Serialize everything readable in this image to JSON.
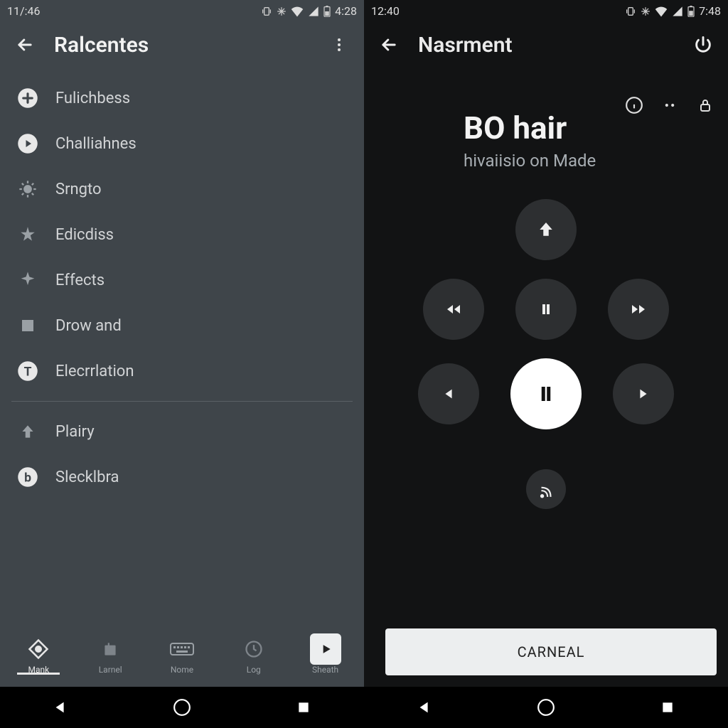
{
  "left": {
    "status": {
      "time": "11/:46",
      "clock": "4:28"
    },
    "appbar": {
      "title": "Ralcentes"
    },
    "list": [
      {
        "icon": "plus-circle-icon",
        "label": "Fulichbess"
      },
      {
        "icon": "play-circle-icon",
        "label": "Challiahnes"
      },
      {
        "icon": "sun-icon",
        "label": "Srngto"
      },
      {
        "icon": "star-icon",
        "label": "Edicdiss"
      },
      {
        "icon": "sparkle-icon",
        "label": "Effects"
      },
      {
        "icon": "square-icon",
        "label": "Drow and"
      },
      {
        "icon": "t-circle-icon",
        "label": "Elecrrlation"
      }
    ],
    "list2": [
      {
        "icon": "arrow-up-icon",
        "label": "Plairy"
      },
      {
        "icon": "b-circle-icon",
        "label": "Slecklbra"
      }
    ],
    "bnav": [
      {
        "label": "Mank",
        "icon": "diamond-icon",
        "active": true
      },
      {
        "label": "Larnel",
        "icon": "box-icon"
      },
      {
        "label": "Nome",
        "icon": "keyboard-icon"
      },
      {
        "label": "Log",
        "icon": "refresh-icon"
      },
      {
        "label": "Sheath",
        "icon": "play-box-icon"
      }
    ]
  },
  "right": {
    "status": {
      "time": "12:40",
      "clock": "7:48"
    },
    "appbar": {
      "title": "Nasrment"
    },
    "media": {
      "title": "BO hair",
      "subtitle": "hivaiisio on Made"
    },
    "button": {
      "label": "CARNEAL"
    }
  }
}
